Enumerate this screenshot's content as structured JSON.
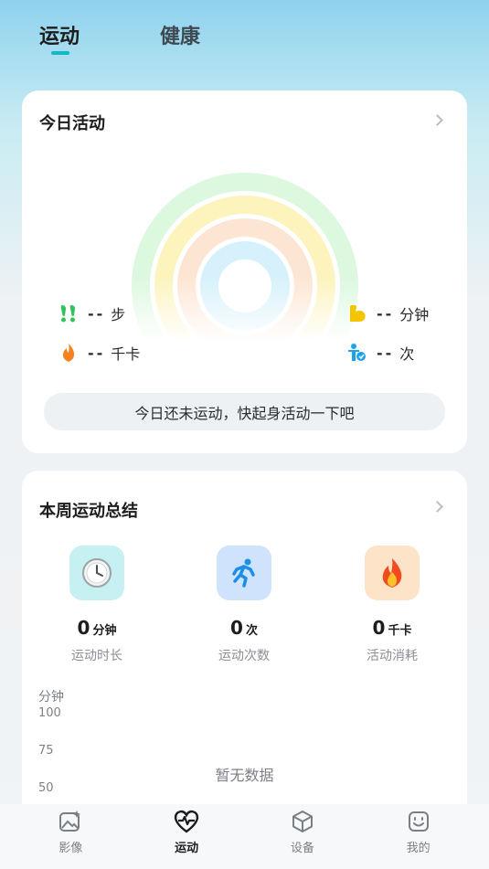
{
  "top_tabs": [
    {
      "label": "运动",
      "active": true
    },
    {
      "label": "健康",
      "active": false
    }
  ],
  "today": {
    "title": "今日活动",
    "stats": {
      "steps": {
        "value": "--",
        "unit": "步",
        "icon": "footprints-icon",
        "color": "#2ec35b"
      },
      "duration": {
        "value": "--",
        "unit": "分钟",
        "icon": "flexed-arm-icon",
        "color": "#f5c400"
      },
      "calories": {
        "value": "--",
        "unit": "千卡",
        "icon": "flame-icon",
        "color": "#f5821f"
      },
      "count": {
        "value": "--",
        "unit": "次",
        "icon": "standing-person-icon",
        "color": "#1aa3e8"
      }
    },
    "message": "今日还未运动，快起身活动一下吧",
    "ring_colors": [
      "#dcf8df",
      "#fcf3bd",
      "#fde5d3",
      "#d6f1fb"
    ]
  },
  "weekly": {
    "title": "本周运动总结",
    "items": [
      {
        "value": "0",
        "unit": "分钟",
        "label": "运动时长",
        "icon": "clock-icon",
        "bg": "#c6f0f2"
      },
      {
        "value": "0",
        "unit": "次",
        "label": "运动次数",
        "icon": "running-icon",
        "bg": "#cfe3fd"
      },
      {
        "value": "0",
        "unit": "千卡",
        "label": "活动消耗",
        "icon": "fire-icon",
        "bg": "#fde3c7"
      }
    ],
    "chart": {
      "unit_label": "分钟",
      "ticks": [
        "100",
        "75",
        "50"
      ],
      "empty_text": "暂无数据"
    }
  },
  "bottom_nav": [
    {
      "label": "影像",
      "icon": "image-icon",
      "active": false
    },
    {
      "label": "运动",
      "icon": "heart-pulse-icon",
      "active": true
    },
    {
      "label": "设备",
      "icon": "cube-icon",
      "active": false
    },
    {
      "label": "我的",
      "icon": "smile-face-icon",
      "active": false
    }
  ]
}
